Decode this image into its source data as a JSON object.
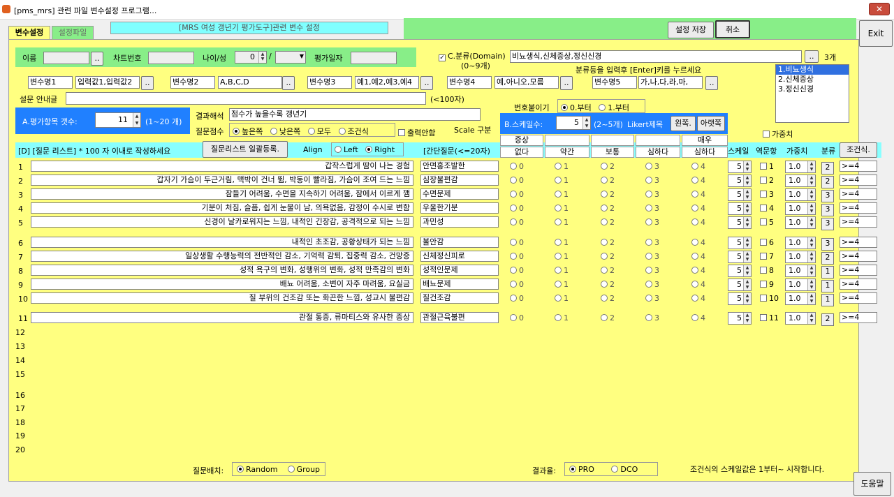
{
  "window": {
    "title": "[pms_mrs] 관련 파일 변수설정 프로그램..."
  },
  "toolbar": {
    "save": "설정 저장",
    "cancel": "취소",
    "exit": "Exit",
    "help": "도움말"
  },
  "tabs": [
    {
      "label": "변수설정"
    },
    {
      "label": "설정파일"
    }
  ],
  "header_banner": "[MRS 여성 갱년기 평가도구]관련 변수 설정",
  "patient": {
    "name_label": "이름",
    "chart_label": "차트번호",
    "age_label": "나이/성",
    "age_value": "0",
    "date_label": "평가일자",
    "dots": ".."
  },
  "domain": {
    "check_label": "C.분류(Domain)",
    "range_hint": "(0~9개)",
    "value": "비뇨생식,신체증상,정신신경",
    "count": "3개",
    "hint": "분류등을 입력후 [Enter]키를 누르세요",
    "items": [
      "1.비뇨생식",
      "2.신체증상",
      "3.정신신경"
    ],
    "weight_label": "가중치"
  },
  "vars": [
    {
      "name": "변수명1",
      "value": "입력값1,입력값2"
    },
    {
      "name": "변수명2",
      "value": "A,B,C,D"
    },
    {
      "name": "변수명3",
      "value": "예1,예2,예3,예4"
    },
    {
      "name": "변수명4",
      "value": "예,아니오,모름"
    },
    {
      "name": "변수명5",
      "value": "가,나,다,라,마,"
    }
  ],
  "intro_label": "설문 안내글",
  "intro_limit": "(<100자)",
  "items_count": {
    "label": "A.평가항목 갯수:",
    "value": "11",
    "range": "(1~20 개)"
  },
  "result": {
    "label": "결과해석",
    "value": "점수가 높을수록 갱년기",
    "score_label": "질문점수",
    "options": [
      "높은쪽",
      "낮은쪽",
      "모두",
      "조건식"
    ],
    "selected": 0,
    "print_label": "출력안함"
  },
  "numbering": {
    "label": "번호붙이기",
    "options": [
      "0.부터",
      "1.부터"
    ],
    "selected": 0
  },
  "scale": {
    "label": "B.스케일수:",
    "value": "5",
    "range": "(2~5개)",
    "likert": "Likert제목",
    "left": "왼쪽.",
    "right": "아랫쪽",
    "scale_div": "Scale 구분"
  },
  "list_header": {
    "title": "[D] [질문 리스트] * 100 자 이내로 작성하세요",
    "bulk": "질문리스트 일괄등록.",
    "align_label": "Align",
    "align": [
      "Left",
      "Right"
    ],
    "align_sel": 1,
    "short_label": "[간단질문(<=20자)",
    "scale_col": "스케일",
    "reverse_col": "역문항",
    "weight_col": "가중치",
    "cat_col": "분류",
    "cond_col": "조건식."
  },
  "likert_top": [
    "증상",
    "",
    "",
    "",
    "매우"
  ],
  "likert_bottom": [
    "없다",
    "약간",
    "보통",
    "심하다",
    "심하다"
  ],
  "questions": [
    {
      "n": "1",
      "text": "갑작스럽게 땀이 나는 경험",
      "short": "안면홍조발한",
      "scale": "5",
      "weight": "1.0",
      "cat": "2",
      "cond": ">=4"
    },
    {
      "n": "2",
      "text": "갑자기 가슴이 두근거림, 맥박이 건너 뜀, 박동이 빨라짐, 가슴이 조여 드는 느낌",
      "short": "심장불편감",
      "scale": "5",
      "weight": "1.0",
      "cat": "2",
      "cond": ">=4"
    },
    {
      "n": "3",
      "text": "잠들기 어려움, 수면을 지속하기 어려움, 잠에서 이르게 깸",
      "short": "수면문제",
      "scale": "5",
      "weight": "1.0",
      "cat": "3",
      "cond": ">=4"
    },
    {
      "n": "4",
      "text": "기분이 처짐, 슬픔, 쉽게 눈물이 남, 의욕없음, 감정이 수시로 변함",
      "short": "우울한기분",
      "scale": "5",
      "weight": "1.0",
      "cat": "3",
      "cond": ">=4"
    },
    {
      "n": "5",
      "text": "신경이 날카로워지는 느낌, 내적인 긴장감, 공격적으로 되는 느낌",
      "short": "과민성",
      "scale": "5",
      "weight": "1.0",
      "cat": "3",
      "cond": ">=4"
    },
    {
      "n": "6",
      "text": "내적인 초조감, 공황상태가 되는 느낌",
      "short": "불안감",
      "scale": "5",
      "weight": "1.0",
      "cat": "3",
      "cond": ">=4"
    },
    {
      "n": "7",
      "text": "일상생활 수행능력의 전반적인 감소, 기억력 감퇴, 집중력 감소, 건망증",
      "short": "신체정신피로",
      "scale": "5",
      "weight": "1.0",
      "cat": "2",
      "cond": ">=4"
    },
    {
      "n": "8",
      "text": "성적 욕구의 변화, 성행위의 변화, 성적 만족감의 변화",
      "short": "성적인문제",
      "scale": "5",
      "weight": "1.0",
      "cat": "1",
      "cond": ">=4"
    },
    {
      "n": "9",
      "text": "배뇨 어려움, 소변이 자주 마려움, 요실금",
      "short": "배뇨문제",
      "scale": "5",
      "weight": "1.0",
      "cat": "1",
      "cond": ">=4"
    },
    {
      "n": "10",
      "text": "질 부위의 건조감 또는 화끈한 느낌, 성교시 불편감",
      "short": "질건조감",
      "scale": "5",
      "weight": "1.0",
      "cat": "1",
      "cond": ">=4"
    },
    {
      "n": "11",
      "text": "관절 통증, 류마티스와 유사한 증상",
      "short": "관절근육불편",
      "scale": "5",
      "weight": "1.0",
      "cat": "2",
      "cond": ">=4"
    }
  ],
  "empty_rows": [
    "12",
    "13",
    "14",
    "15",
    "16",
    "17",
    "18",
    "19",
    "20"
  ],
  "scale_values": [
    "0",
    "1",
    "2",
    "3",
    "4"
  ],
  "footer": {
    "q_layout_label": "질문배치:",
    "q_layout": [
      "Random",
      "Group"
    ],
    "q_sel": 0,
    "result_label": "결과율:",
    "result_opts": [
      "PRO",
      "DCO"
    ],
    "result_sel": 0,
    "note": "조건식의 스케일값은 1부터~ 시작합니다."
  }
}
